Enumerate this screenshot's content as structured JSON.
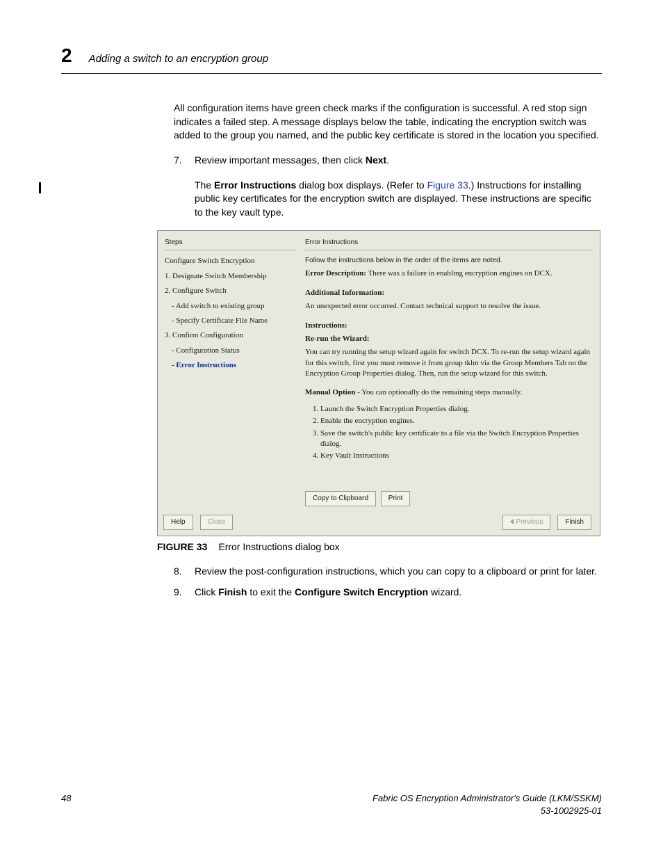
{
  "header": {
    "chapter_number": "2",
    "chapter_title": "Adding a switch to an encryption group"
  },
  "intro_para": "All configuration items have green check marks if the configuration is successful. A red stop sign indicates a failed step. A message displays below the table, indicating the encryption switch was added to the group you named, and the public key certificate is stored in the location you specified.",
  "step7": {
    "pre": "Review important messages, then click ",
    "bold": "Next",
    "post": "."
  },
  "step7_body": {
    "p1": "The ",
    "b1": "Error Instructions",
    "p2": " dialog box displays. (Refer to ",
    "link": "Figure 33",
    "p3": ".) Instructions for installing public key certificates for the encryption switch are displayed. These instructions are specific to the key vault type."
  },
  "figure": {
    "left": {
      "header": "Steps",
      "items": [
        "Configure Switch Encryption",
        "1. Designate Switch Membership",
        "2. Configure Switch",
        "- Add switch to existing group",
        "- Specify Certificate File Name",
        "3. Confirm Configuration",
        "- Configuration Status",
        "- Error Instructions"
      ],
      "active_index": 7
    },
    "right": {
      "header": "Error Instructions",
      "intro": "Follow the instructions below in the order of the items are noted.",
      "err_label": "Error Description:",
      "err_text": " There was a failure in enabling encryption engines on DCX.",
      "addl_label": "Additional Information:",
      "addl_text": "An unexpected error occurred. Contact technical support to resolve the issue.",
      "instr_label": "Instructions:",
      "rerun_label": "Re-run the Wizard:",
      "rerun_text": "You can try running the setup wizard again for switch DCX. To re-run the setup wizard again for this switch, first you must remove it from group tklm via the Group Members Tab on the Encryption Group Properties dialog. Then, run the setup wizard for this switch.",
      "manual_label": "Manual Option",
      "manual_text": " - You can optionally do the remaining steps manually.",
      "manual_steps": [
        "Launch the Switch Encryption Properties dialog.",
        "Enable the encryption engines.",
        "Save the switch's public key certificate to a file via the Switch Encryption Properties dialog.",
        "Key Vault Instructions"
      ],
      "btn_copy": "Copy to Clipboard",
      "btn_print": "Print"
    },
    "footer": {
      "help": "Help",
      "close": "Close",
      "previous": "Previous",
      "finish": "Finish"
    }
  },
  "caption": {
    "num": "FIGURE 33",
    "text": "Error Instructions dialog box"
  },
  "step8": "Review the post-configuration instructions, which you can copy to a clipboard or print for later.",
  "step9": {
    "p1": "Click ",
    "b1": "Finish",
    "p2": " to exit the ",
    "b2": "Configure Switch Encryption",
    "p3": " wizard."
  },
  "footer": {
    "page": "48",
    "title": "Fabric OS Encryption Administrator's Guide  (LKM/SSKM)",
    "docnum": "53-1002925-01"
  }
}
